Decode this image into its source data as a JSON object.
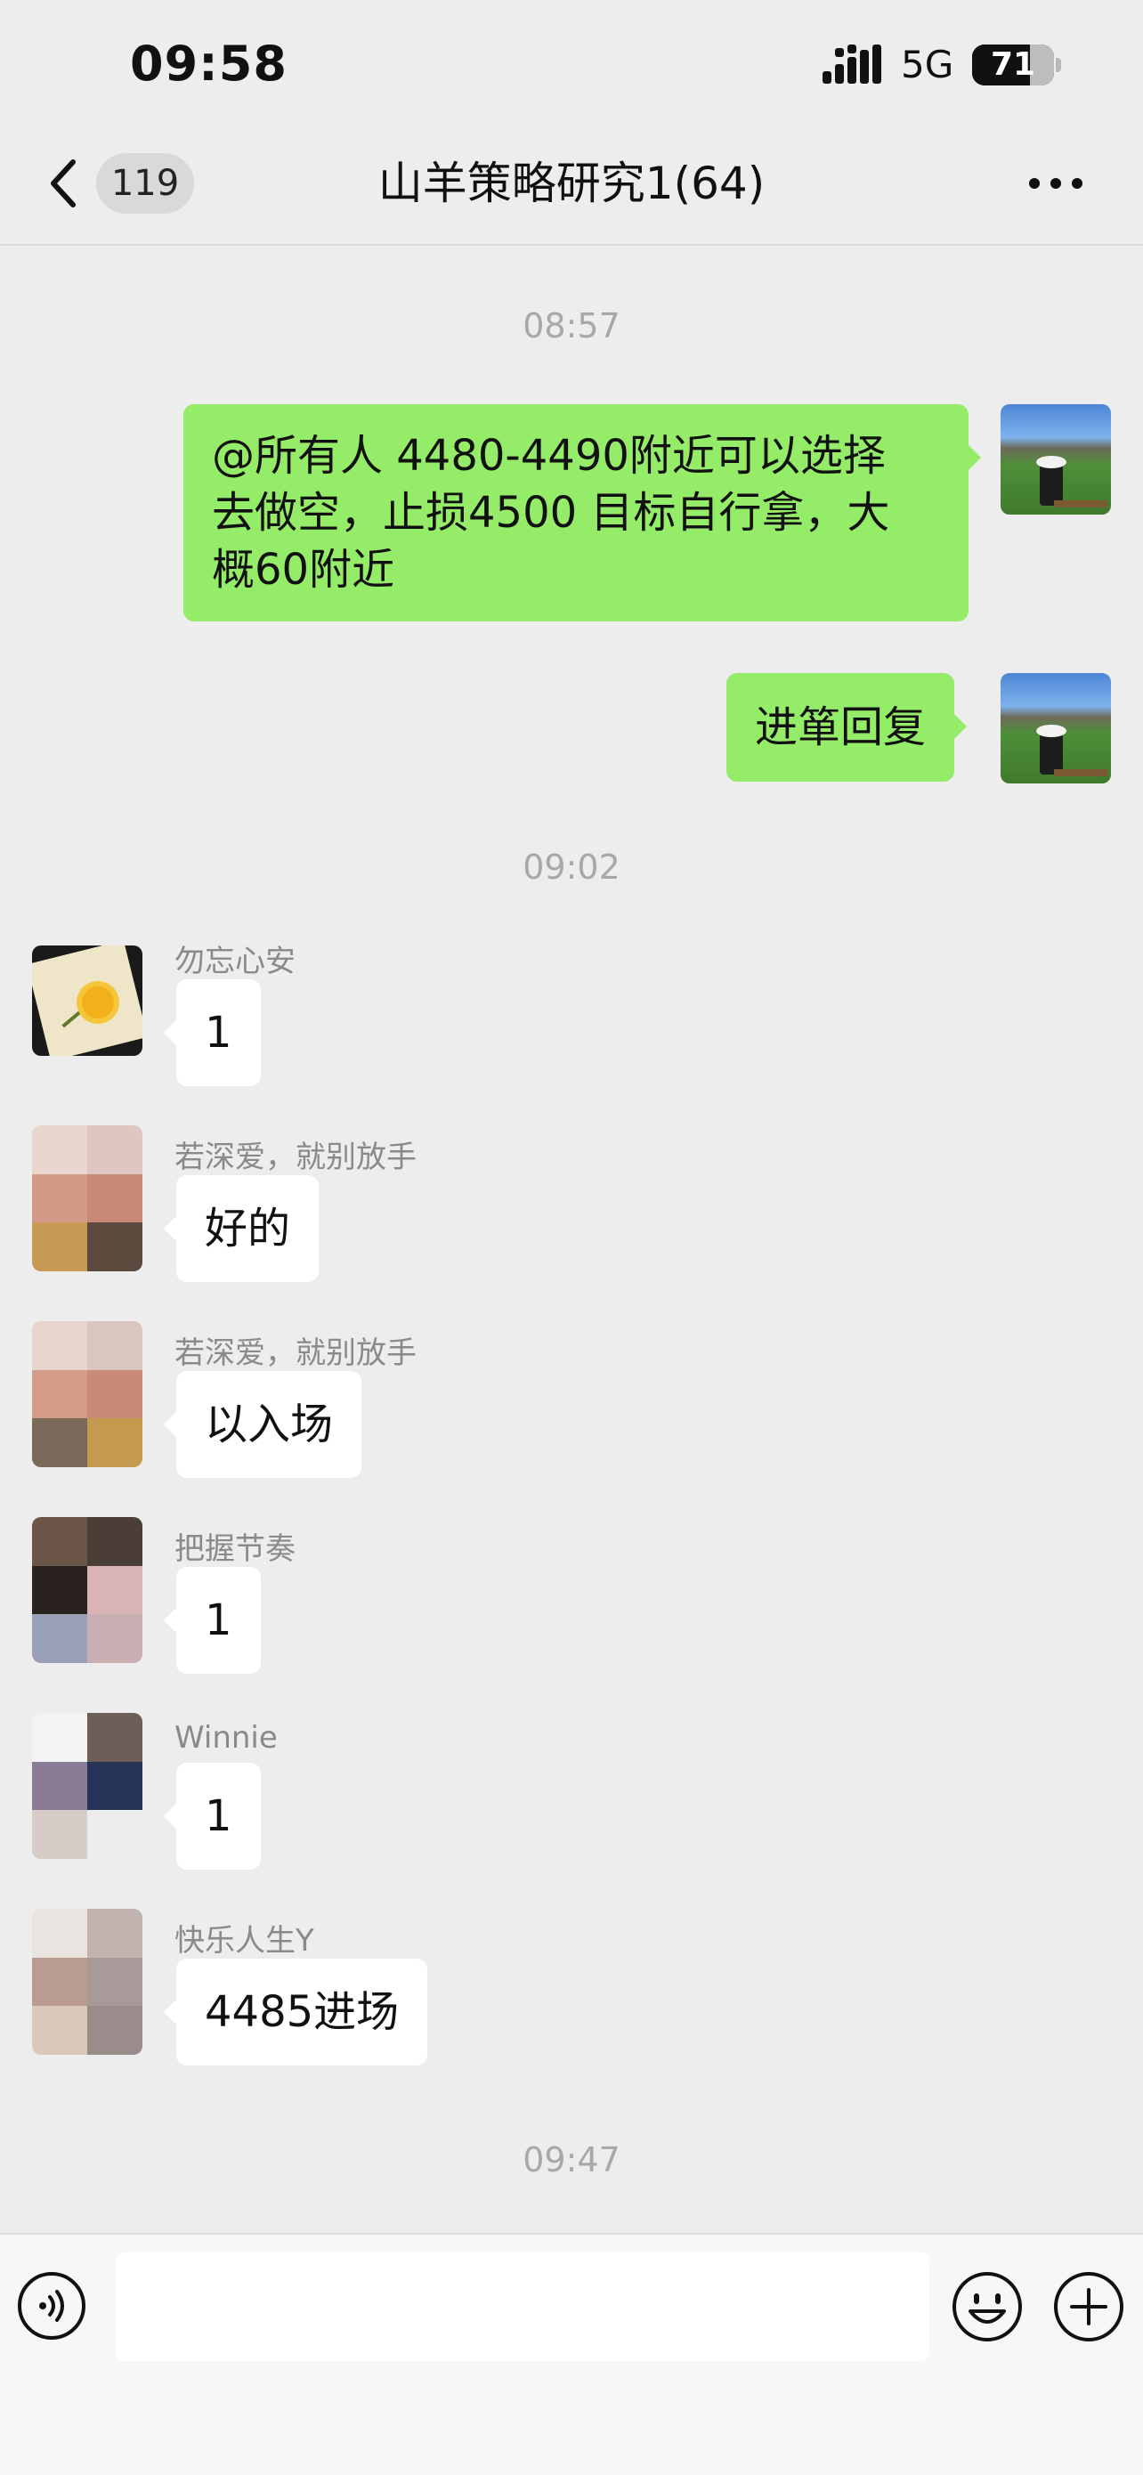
{
  "status_bar": {
    "time": "09:58",
    "network": "5G",
    "battery": "71",
    "battery_level": 0.71
  },
  "nav": {
    "unread_count": "119",
    "title": "山羊策略研究1(64)"
  },
  "timestamps": {
    "t1": "08:57",
    "t2": "09:02",
    "t3": "09:47"
  },
  "messages": [
    {
      "side": "right",
      "text_lines": [
        "@所有人 4480-4490附近可以选择",
        "去做空，止损4500  目标自行拿，大",
        "概60附近"
      ]
    },
    {
      "side": "right",
      "text": "进箪回复"
    },
    {
      "side": "left",
      "sender": "勿忘心安",
      "text": "1"
    },
    {
      "side": "left",
      "sender": "若深爱，就别放手",
      "text": "好的"
    },
    {
      "side": "left",
      "sender": "若深爱，就别放手",
      "text": "以入场"
    },
    {
      "side": "left",
      "sender": "把握节奏",
      "text": "1"
    },
    {
      "side": "left",
      "sender": "Winnie",
      "text": "1"
    },
    {
      "side": "left",
      "sender": "快乐人生Y",
      "text": "4485进场"
    }
  ],
  "input": {
    "value": "",
    "placeholder": ""
  },
  "icons": {
    "back": "chevron-left-icon",
    "more": "more-dots-icon",
    "voice": "voice-icon",
    "emoji": "emoji-icon",
    "plus": "plus-icon"
  },
  "colors": {
    "background": "#ededed",
    "my_bubble": "#95ec69",
    "other_bubble": "#ffffff",
    "timestamp": "#a8a8a8",
    "sender_name": "#8a8a8a"
  }
}
